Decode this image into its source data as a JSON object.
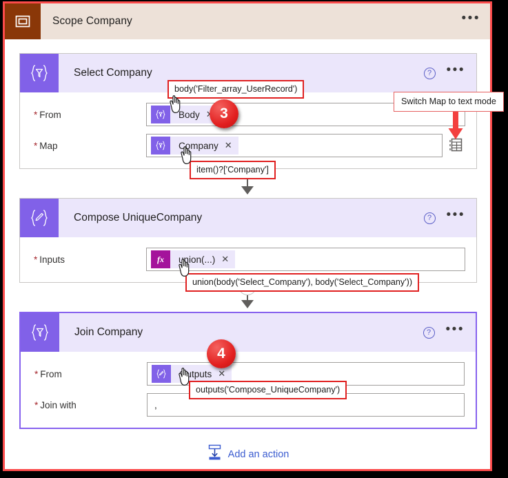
{
  "scope": {
    "icon": "scope-icon",
    "title": "Scope Company",
    "overflow_label": "•••"
  },
  "common": {
    "help_label": "?",
    "overflow_label": "•••",
    "remove_label": "✕",
    "plus_label": "+",
    "required_marker": "*"
  },
  "cards": [
    {
      "id": "select-company",
      "title": "Select Company",
      "icon": "select-action-icon",
      "selected": false,
      "fields": [
        {
          "label": "From",
          "required": true,
          "token": {
            "text": "Body",
            "glyph": "select-token-icon",
            "type": "dynamic"
          }
        },
        {
          "label": "Map",
          "required": true,
          "token": {
            "text": "Company",
            "glyph": "select-token-icon",
            "type": "dynamic"
          },
          "trailing_icon": "switch-to-text-mode-icon"
        }
      ]
    },
    {
      "id": "compose-uniquecompany",
      "title": "Compose UniqueCompany",
      "icon": "compose-action-icon",
      "selected": false,
      "fields": [
        {
          "label": "Inputs",
          "required": true,
          "token": {
            "text": "union(...)",
            "glyph": "fx",
            "type": "expression"
          }
        }
      ]
    },
    {
      "id": "join-company",
      "title": "Join Company",
      "icon": "join-action-icon",
      "selected": true,
      "fields": [
        {
          "label": "From",
          "required": true,
          "token": {
            "text": "Outputs",
            "glyph": "compose-token-icon",
            "type": "dynamic"
          }
        },
        {
          "label": "Join with",
          "required": true,
          "value": ","
        }
      ]
    }
  ],
  "add_action": {
    "label": "Add an action",
    "icon": "add-action-icon"
  },
  "annotations": {
    "from_expression": "body('Filter_array_UserRecord')",
    "map_expression": "item()?['Company']",
    "inputs_expression": "union(body('Select_Company'), body('Select_Company'))",
    "join_from_expression": "outputs('Compose_UniqueCompany')",
    "text_mode_tooltip": "Switch Map to text mode"
  },
  "steps": [
    {
      "number": "3"
    },
    {
      "number": "4"
    }
  ],
  "colors": {
    "scope_header_bg": "#ede1d8",
    "scope_icon_bg": "#8a3708",
    "card_head_bg": "#ebe6fb",
    "card_icon_bg": "#8161e8",
    "token_bg": "#ece7fb",
    "fx_bg": "#a4139b",
    "annotation_border": "#e02020",
    "step_badge": "#e21f1f",
    "link": "#3b5cd0",
    "selected_border": "#8661ee",
    "frame_border": "#fb4b4b"
  }
}
